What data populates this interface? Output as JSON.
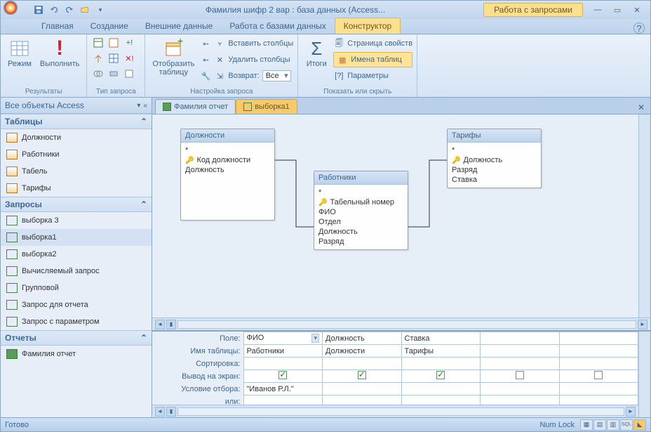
{
  "title": "Фамилия шифр 2 вар : база данных (Access...",
  "context_tab_title": "Работа с запросами",
  "ribbon_tabs": [
    "Главная",
    "Создание",
    "Внешние данные",
    "Работа с базами данных",
    "Конструктор"
  ],
  "ribbon": {
    "group1": {
      "label": "Результаты",
      "btn1": "Режим",
      "btn2": "Выполнить"
    },
    "group2": {
      "label": "Тип запроса"
    },
    "group3": {
      "label": "Настройка запроса",
      "show_table": "Отобразить\nтаблицу",
      "insert_cols": "Вставить столбцы",
      "delete_cols": "Удалить столбцы",
      "return_label": "Возврат:",
      "return_value": "Все"
    },
    "group4": {
      "label": "Показать или скрыть",
      "totals": "Итоги",
      "prop_sheet": "Страница свойств",
      "table_names": "Имена таблиц",
      "parameters": "Параметры"
    }
  },
  "nav": {
    "header": "Все объекты Access",
    "sections": {
      "tables": {
        "label": "Таблицы",
        "items": [
          "Должности",
          "Работники",
          "Табель",
          "Тарифы"
        ]
      },
      "queries": {
        "label": "Запросы",
        "items": [
          "выборка 3",
          "выборка1",
          "выборка2",
          "Вычисляемый запрос",
          "Групповой",
          "Запрос для отчета",
          "Запрос с параметром"
        ]
      },
      "reports": {
        "label": "Отчеты",
        "items": [
          "Фамилия отчет"
        ]
      }
    }
  },
  "doc_tabs": [
    {
      "label": "Фамилия отчет",
      "active": false
    },
    {
      "label": "выборка1",
      "active": true
    }
  ],
  "tables_diagram": {
    "t1": {
      "title": "Должности",
      "fields": [
        "*",
        "Код должности",
        "Должность"
      ],
      "keys": [
        1
      ]
    },
    "t2": {
      "title": "Работники",
      "fields": [
        "*",
        "Табельный номер",
        "ФИО",
        "Отдел",
        "Должность",
        "Разряд"
      ],
      "keys": [
        1
      ]
    },
    "t3": {
      "title": "Тарифы",
      "fields": [
        "*",
        "Должность",
        "Разряд",
        "Ставка"
      ],
      "keys": [
        1
      ]
    }
  },
  "grid": {
    "row_labels": [
      "Поле:",
      "Имя таблицы:",
      "Сортировка:",
      "Вывод на экран:",
      "Условие отбора:",
      "или:"
    ],
    "cols": [
      {
        "field": "ФИО",
        "table": "Работники",
        "show": true,
        "criteria": "\"Иванов Р.Л.\""
      },
      {
        "field": "Должность",
        "table": "Должности",
        "show": true,
        "criteria": ""
      },
      {
        "field": "Ставка",
        "table": "Тарифы",
        "show": true,
        "criteria": ""
      },
      {
        "field": "",
        "table": "",
        "show": false,
        "criteria": ""
      },
      {
        "field": "",
        "table": "",
        "show": false,
        "criteria": ""
      }
    ]
  },
  "status": {
    "ready": "Готово",
    "numlock": "Num Lock"
  }
}
